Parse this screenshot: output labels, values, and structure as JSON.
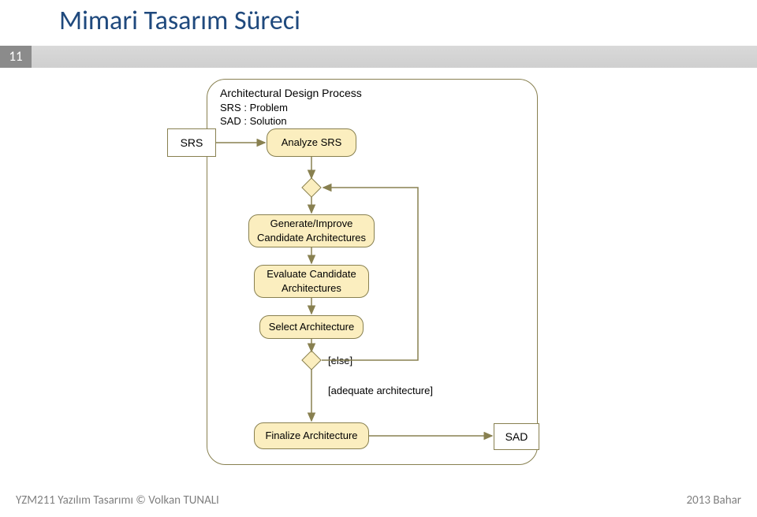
{
  "title": "Mimari Tasarım Süreci",
  "page_number": "11",
  "frame": {
    "title": "Architectural Design Process",
    "line1": "SRS : Problem",
    "line2": "SAD : Solution"
  },
  "nodes": {
    "srs": "SRS",
    "analyze": "Analyze SRS",
    "generate": "Generate/Improve\nCandidate Architectures",
    "evaluate": "Evaluate Candidate\nArchitectures",
    "select": "Select Architecture",
    "finalize": "Finalize Architecture",
    "sad": "SAD"
  },
  "guards": {
    "else": "[else]",
    "adequate": "[adequate architecture]"
  },
  "footer": {
    "left": "YZM211 Yazılım Tasarımı © Volkan TUNALI",
    "right": "2013 Bahar"
  },
  "chart_data": {
    "type": "diagram",
    "diagram_type": "uml-activity",
    "frame_title": "Architectural Design Process",
    "legend": [
      "SRS : Problem",
      "SAD : Solution"
    ],
    "nodes": [
      {
        "id": "srs",
        "label": "SRS",
        "kind": "object"
      },
      {
        "id": "analyze",
        "label": "Analyze SRS",
        "kind": "activity"
      },
      {
        "id": "merge1",
        "label": "",
        "kind": "merge"
      },
      {
        "id": "generate",
        "label": "Generate/Improve Candidate Architectures",
        "kind": "activity"
      },
      {
        "id": "evaluate",
        "label": "Evaluate Candidate Architectures",
        "kind": "activity"
      },
      {
        "id": "select",
        "label": "Select Architecture",
        "kind": "activity"
      },
      {
        "id": "decision",
        "label": "",
        "kind": "decision"
      },
      {
        "id": "finalize",
        "label": "Finalize Architecture",
        "kind": "activity"
      },
      {
        "id": "sad",
        "label": "SAD",
        "kind": "object"
      }
    ],
    "edges": [
      {
        "from": "srs",
        "to": "analyze"
      },
      {
        "from": "analyze",
        "to": "merge1"
      },
      {
        "from": "merge1",
        "to": "generate"
      },
      {
        "from": "generate",
        "to": "evaluate"
      },
      {
        "from": "evaluate",
        "to": "select"
      },
      {
        "from": "select",
        "to": "decision"
      },
      {
        "from": "decision",
        "to": "finalize",
        "guard": "[adequate architecture]"
      },
      {
        "from": "decision",
        "to": "merge1",
        "guard": "[else]"
      },
      {
        "from": "finalize",
        "to": "sad"
      }
    ]
  }
}
